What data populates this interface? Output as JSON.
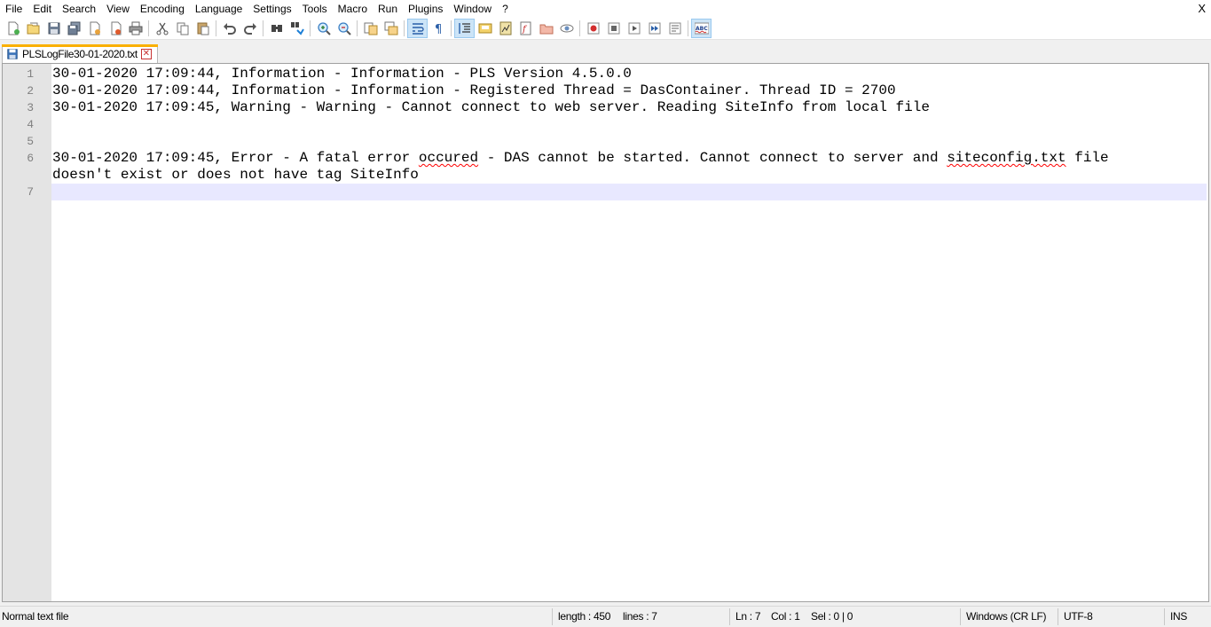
{
  "menu": {
    "items": [
      "File",
      "Edit",
      "Search",
      "View",
      "Encoding",
      "Language",
      "Settings",
      "Tools",
      "Macro",
      "Run",
      "Plugins",
      "Window",
      "?"
    ],
    "close_label": "X"
  },
  "toolbar": {
    "buttons": [
      "new-file-icon",
      "open-file-icon",
      "save-icon",
      "save-all-icon",
      "close-icon",
      "close-all-icon",
      "print-icon",
      "cut-icon",
      "copy-icon",
      "paste-icon",
      "undo-icon",
      "redo-icon",
      "find-icon",
      "replace-icon",
      "zoom-in-icon",
      "zoom-out-icon",
      "sync-vertical-icon",
      "sync-horizontal-icon",
      "word-wrap-icon",
      "show-all-characters-icon",
      "indent-guide-icon",
      "define-language-icon",
      "document-map-icon",
      "function-list-icon",
      "folder-as-workspace-icon",
      "monitoring-icon",
      "record-macro-icon",
      "stop-recording-icon",
      "play-macro-icon",
      "run-macro-multiple-icon",
      "save-macro-icon",
      "spell-check-icon"
    ]
  },
  "tab": {
    "label": "PLSLogFile30-01-2020.txt",
    "close_symbol": "✕"
  },
  "editor": {
    "line_numbers": [
      "1",
      "2",
      "3",
      "4",
      "5",
      "6",
      "",
      "7"
    ],
    "lines": [
      "30-01-2020 17:09:44, Information - Information - PLS Version 4.5.0.0",
      "30-01-2020 17:09:44, Information - Information - Registered Thread = DasContainer. Thread ID = 2700",
      "30-01-2020 17:09:45, Warning - Warning - Cannot connect to web server. Reading SiteInfo from local file",
      "",
      "",
      "30-01-2020 17:09:45, Error - A fatal error occured - DAS cannot be started. Cannot connect to server and siteconfig.txt file",
      "doesn't exist or does not have tag SiteInfo",
      ""
    ],
    "line6": {
      "part1": "30-01-2020 17:09:45, Error - A fatal error ",
      "misspelled1": "occured",
      "part2": " - DAS cannot be started. Cannot connect to server and ",
      "misspelled2": "siteconfig.txt",
      "part3": " file"
    }
  },
  "statusbar": {
    "file_type": "Normal text file",
    "length": "length : 450",
    "lines": "lines : 7",
    "ln": "Ln : 7",
    "col": "Col : 1",
    "sel": "Sel : 0 | 0",
    "eol": "Windows (CR LF)",
    "encoding": "UTF-8",
    "mode": "INS"
  }
}
